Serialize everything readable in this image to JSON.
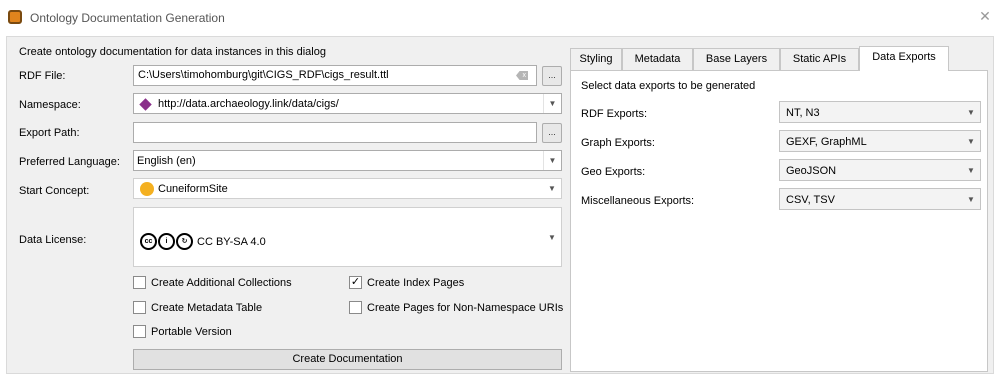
{
  "window": {
    "title": "Ontology Documentation Generation"
  },
  "form": {
    "intro": "Create ontology documentation for data instances in this dialog",
    "rdf_file": {
      "label": "RDF File:",
      "value": "C:\\Users\\timohomburg\\git\\CIGS_RDF\\cigs_result.ttl",
      "browse": "..."
    },
    "namespace": {
      "label": "Namespace:",
      "value": "http://data.archaeology.link/data/cigs/"
    },
    "export_path": {
      "label": "Export Path:",
      "value": "",
      "browse": "..."
    },
    "language": {
      "label": "Preferred Language:",
      "value": "English (en)"
    },
    "start_concept": {
      "label": "Start Concept:",
      "value": "CuneiformSite"
    },
    "license": {
      "label": "Data License:",
      "value": "CC BY-SA 4.0"
    },
    "checkboxes": [
      {
        "label": "Create Additional Collections",
        "checked": false
      },
      {
        "label": "Create Index Pages",
        "checked": true
      },
      {
        "label": "Create Metadata Table",
        "checked": false
      },
      {
        "label": "Create Pages for Non-Namespace URIs",
        "checked": false
      },
      {
        "label": "Portable Version",
        "checked": false
      }
    ],
    "create_button": "Create Documentation"
  },
  "tabs": [
    "Styling",
    "Metadata",
    "Base Layers",
    "Static APIs",
    "Data Exports"
  ],
  "active_tab": "Data Exports",
  "exports": {
    "heading": "Select data exports to be generated",
    "rows": [
      {
        "label": "RDF Exports:",
        "value": "NT, N3"
      },
      {
        "label": "Graph Exports:",
        "value": "GEXF, GraphML"
      },
      {
        "label": "Geo Exports:",
        "value": "GeoJSON"
      },
      {
        "label": "Miscellaneous Exports:",
        "value": "CSV, TSV"
      }
    ]
  },
  "glyphs": {
    "check": "✓",
    "arrow": "▼",
    "close": "✕",
    "clear": "x"
  },
  "colors": {
    "accent_icon": "#e0841d",
    "start_concept_dot": "#f4b020",
    "namespace_icon": "#8a2f8a"
  }
}
